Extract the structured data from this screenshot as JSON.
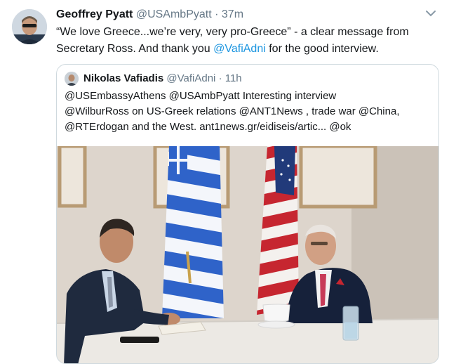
{
  "tweet": {
    "author_name": "Geoffrey Pyatt",
    "author_handle": "@USAmbPyatt",
    "separator": "·",
    "time": "37m",
    "text_line1": "“We love Greece...we’re very, very pro-Greece” - a clear message from",
    "text_line2a": "Secretary Ross.  And thank you ",
    "mention": "@VafiAdni",
    "text_line2b": " for the good interview."
  },
  "quoted": {
    "author_name": "Nikolas Vafiadis",
    "author_handle": "@VafiAdni",
    "separator": "·",
    "time": "11h",
    "lines": [
      "@USEmbassyAthens @USAmbPyatt  Interesting interview",
      "@WilburRoss on US-Greek relations  @ANT1News  , trade war @China,",
      "@RTErdogan  and the West. ant1news.gr/eidiseis/artic... @ok"
    ]
  },
  "icons": {
    "menu": "chevron-down-icon",
    "avatar": "avatar-photo",
    "quoted_avatar": "avatar-photo"
  },
  "colors": {
    "link": "#1b95e0",
    "muted": "#657786",
    "border": "#cfd9de",
    "text": "#14171a"
  }
}
